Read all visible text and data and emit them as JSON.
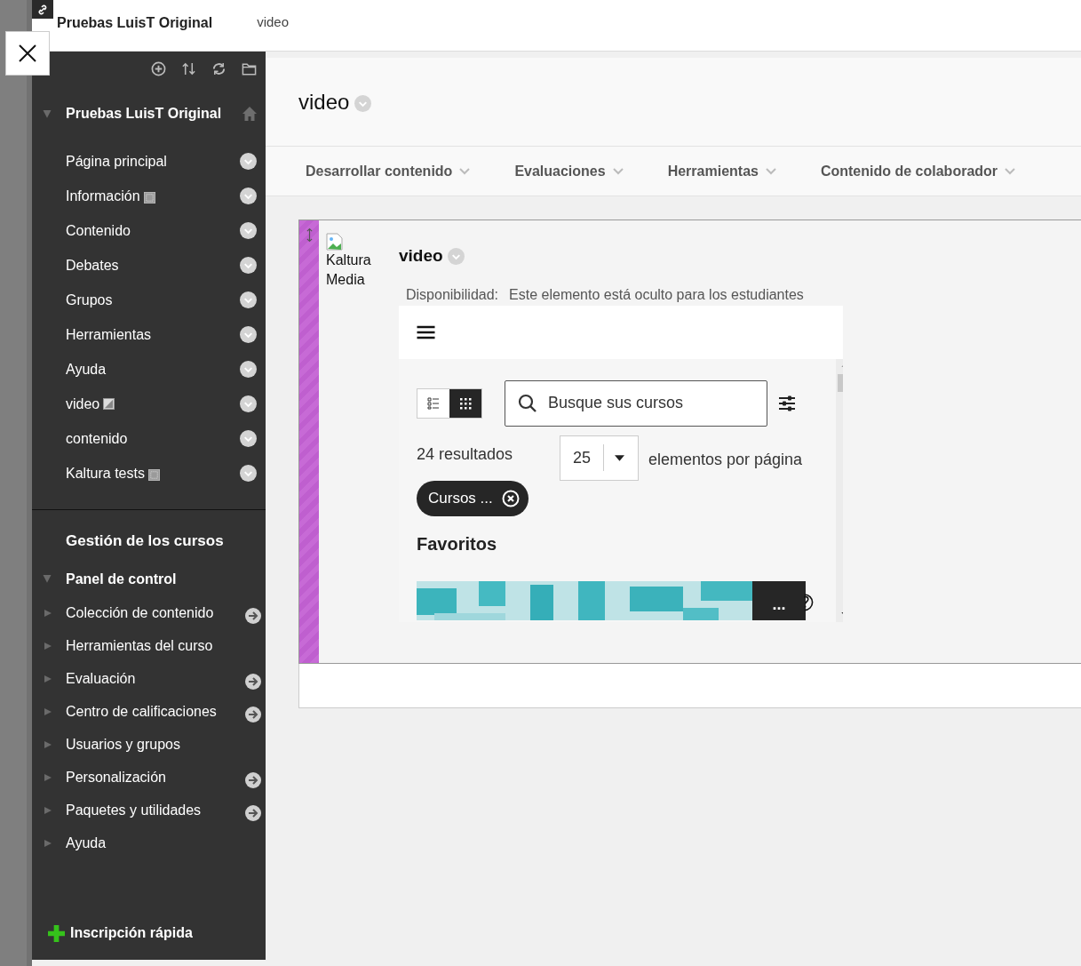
{
  "header": {
    "course": "Pruebas LuisT Original",
    "breadcrumb": "video"
  },
  "sidebar": {
    "course_title": "Pruebas LuisT Original",
    "course_expanded": true,
    "items": [
      {
        "label": "Página principal",
        "kind": "plain"
      },
      {
        "label": "Información",
        "kind": "empty"
      },
      {
        "label": "Contenido",
        "kind": "plain"
      },
      {
        "label": "Debates",
        "kind": "plain"
      },
      {
        "label": "Grupos",
        "kind": "plain"
      },
      {
        "label": "Herramientas",
        "kind": "plain"
      },
      {
        "label": "Ayuda",
        "kind": "plain"
      },
      {
        "label": "video",
        "kind": "hidden"
      },
      {
        "label": "contenido",
        "kind": "plain"
      },
      {
        "label": "Kaltura tests",
        "kind": "empty"
      }
    ],
    "management_title": "Gestión de los cursos",
    "control_panel": {
      "label": "Panel de control",
      "expanded": true,
      "items": [
        {
          "label": "Colección de contenido",
          "expanded": false,
          "kind": "link"
        },
        {
          "label": "Herramientas del curso",
          "expanded": false,
          "kind": "plain"
        },
        {
          "label": "Evaluación",
          "expanded": false,
          "kind": "link"
        },
        {
          "label": "Centro de calificaciones",
          "expanded": false,
          "kind": "link"
        },
        {
          "label": "Usuarios y grupos",
          "expanded": false,
          "kind": "plain"
        },
        {
          "label": "Personalización",
          "expanded": false,
          "kind": "link"
        },
        {
          "label": "Paquetes y utilidades",
          "expanded": false,
          "kind": "link"
        },
        {
          "label": "Ayuda",
          "expanded": false,
          "kind": "plain"
        }
      ]
    },
    "quick_enroll": "Inscripción rápida"
  },
  "page": {
    "title": "video",
    "menu": [
      "Desarrollar contenido",
      "Evaluaciones",
      "Herramientas",
      "Contenido de colaborador"
    ],
    "item": {
      "image_alt": "Kaltura Media",
      "title": "video",
      "availability_label": "Disponibilidad:",
      "availability": "Este elemento está oculto para los estudiantes",
      "embed": {
        "view_toggle": [
          {
            "selected": false
          },
          {
            "selected": true
          }
        ],
        "search": {
          "placeholder": "Busque sus cursos"
        },
        "results": "24 resultados",
        "page_size": "25",
        "page_size_label": "elementos por página",
        "filter_chip": "Cursos ...",
        "section": "Favoritos",
        "more": "..."
      }
    }
  }
}
